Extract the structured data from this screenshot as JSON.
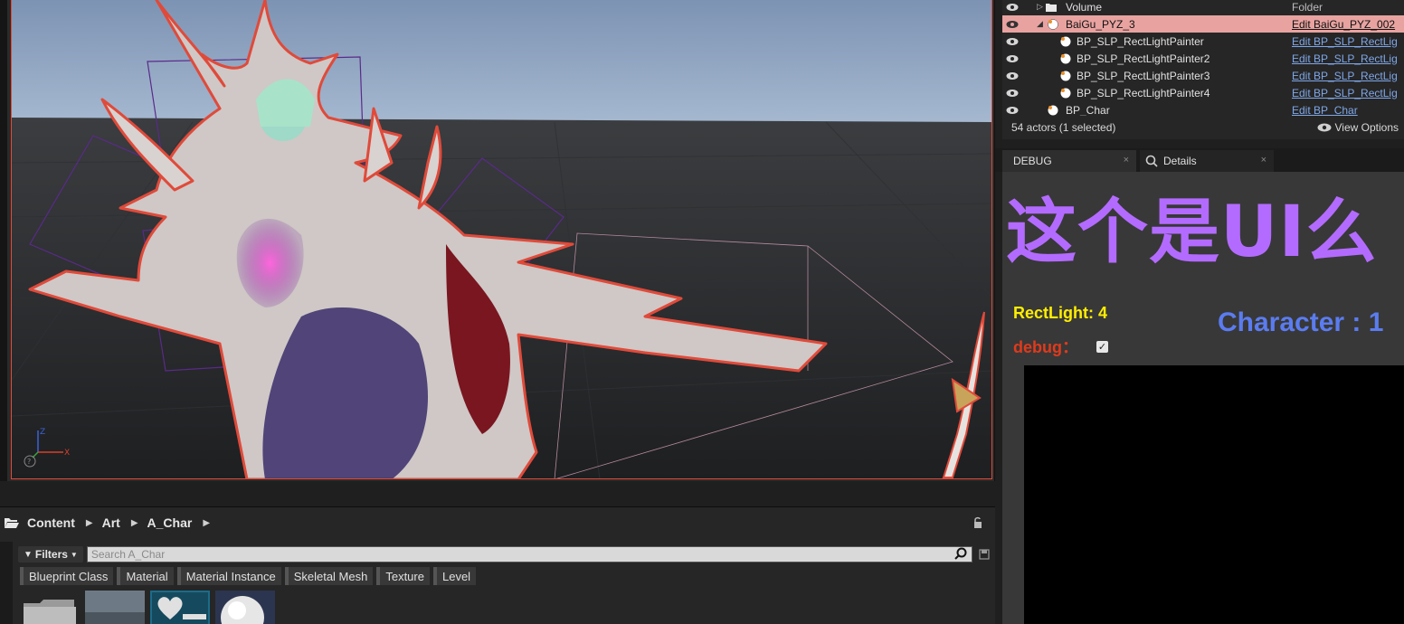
{
  "outliner": {
    "rows": [
      {
        "label": "Volume",
        "type": "Folder",
        "type_is_link": false,
        "selected": false,
        "indent": 1,
        "icon": "folder-icon"
      },
      {
        "label": "BaiGu_PYZ_3",
        "type": "Edit BaiGu_PYZ_002",
        "type_is_link": true,
        "selected": true,
        "indent": 1,
        "icon": "actor-ball-icon"
      },
      {
        "label": "BP_SLP_RectLightPainter",
        "type": "Edit BP_SLP_RectLig",
        "type_is_link": true,
        "selected": false,
        "indent": 2,
        "icon": "actor-ball-icon"
      },
      {
        "label": "BP_SLP_RectLightPainter2",
        "type": "Edit BP_SLP_RectLig",
        "type_is_link": true,
        "selected": false,
        "indent": 2,
        "icon": "actor-ball-icon"
      },
      {
        "label": "BP_SLP_RectLightPainter3",
        "type": "Edit BP_SLP_RectLig",
        "type_is_link": true,
        "selected": false,
        "indent": 2,
        "icon": "actor-ball-icon"
      },
      {
        "label": "BP_SLP_RectLightPainter4",
        "type": "Edit BP_SLP_RectLig",
        "type_is_link": true,
        "selected": false,
        "indent": 2,
        "icon": "actor-ball-icon"
      },
      {
        "label": "BP_Char",
        "type": "Edit BP_Char",
        "type_is_link": true,
        "selected": false,
        "indent": 1,
        "icon": "actor-ball-icon"
      }
    ],
    "footer_count": "54 actors (1 selected)",
    "view_options": "View Options"
  },
  "tabs": {
    "debug": "DEBUG",
    "details": "Details"
  },
  "debug_panel": {
    "title": "这个是UI么",
    "rect_light": "RectLight: 4",
    "character": "Character : 1",
    "debug_label": "debug：",
    "debug_checked": true
  },
  "content_browser": {
    "breadcrumb": [
      "Content",
      "Art",
      "A_Char"
    ],
    "filters_label": "Filters",
    "search_placeholder": "Search A_Char",
    "type_filters": [
      "Blueprint Class",
      "Material",
      "Material Instance",
      "Skeletal Mesh",
      "Texture",
      "Level"
    ]
  },
  "colors": {
    "title": "#b36bff",
    "rect_light": "#ffee00",
    "character": "#5b7cf0",
    "debug": "#e03a1c",
    "selection": "#e8a3a0",
    "link": "#7fa7e8"
  }
}
